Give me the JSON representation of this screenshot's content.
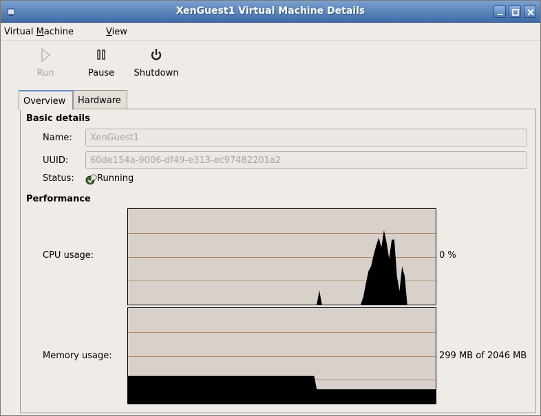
{
  "window": {
    "title": "XenGuest1 Virtual Machine Details"
  },
  "menubar": {
    "virtual_machine": {
      "prefix": "Virtual ",
      "mnemonic": "M",
      "suffix": "achine"
    },
    "view": {
      "prefix": "",
      "mnemonic": "V",
      "suffix": "iew"
    }
  },
  "toolbar": {
    "run": {
      "label": "Run",
      "icon": "play-icon",
      "enabled": false
    },
    "pause": {
      "label": "Pause",
      "icon": "pause-icon",
      "enabled": true
    },
    "shutdown": {
      "label": "Shutdown",
      "icon": "power-icon",
      "enabled": true
    }
  },
  "tabs": [
    {
      "label": "Overview",
      "active": true
    },
    {
      "label": "Hardware",
      "active": false
    }
  ],
  "basic_details": {
    "title": "Basic details",
    "name_label": "Name:",
    "name_value": "XenGuest1",
    "uuid_label": "UUID:",
    "uuid_value": "60de154a-9006-df49-e313-ec97482201a2",
    "status_label": "Status:",
    "status_value": "Running",
    "status_icon": "running-status-icon"
  },
  "performance": {
    "title": "Performance",
    "cpu": {
      "label": "CPU usage:",
      "value": "0 %",
      "history_percent": [
        0,
        0,
        0,
        0,
        0,
        0,
        0,
        0,
        0,
        0,
        0,
        0,
        0,
        0,
        0,
        0,
        0,
        0,
        0,
        0,
        0,
        0,
        0,
        0,
        0,
        0,
        0,
        0,
        0,
        0,
        0,
        0,
        0,
        0,
        0,
        0,
        0,
        0,
        0,
        0,
        0,
        0,
        0,
        0,
        0,
        0,
        0,
        0,
        0,
        0,
        0,
        0,
        0,
        0,
        0,
        0,
        0,
        0,
        0,
        0,
        0,
        0,
        0,
        0,
        0,
        0,
        0,
        0,
        0,
        0,
        0,
        0,
        0,
        0,
        15,
        0,
        0,
        0,
        0,
        0,
        0,
        0,
        0,
        0,
        0,
        0,
        0,
        0,
        0,
        0,
        0,
        8,
        22,
        35,
        40,
        52,
        62,
        70,
        60,
        78,
        65,
        48,
        68,
        68,
        30,
        14,
        40,
        30,
        0,
        0,
        0,
        0,
        0,
        0,
        0,
        0,
        0,
        0,
        0,
        0
      ]
    },
    "memory": {
      "label": "Memory usage:",
      "value": "299 MB of 2046 MB",
      "history_percent": [
        29,
        29,
        29,
        29,
        29,
        29,
        29,
        29,
        29,
        29,
        29,
        29,
        29,
        29,
        29,
        29,
        29,
        29,
        29,
        29,
        29,
        29,
        29,
        29,
        29,
        29,
        29,
        29,
        29,
        29,
        29,
        29,
        29,
        29,
        29,
        29,
        29,
        29,
        29,
        29,
        29,
        29,
        29,
        29,
        29,
        29,
        29,
        29,
        29,
        29,
        29,
        29,
        29,
        29,
        29,
        29,
        29,
        29,
        29,
        29,
        29,
        29,
        29,
        29,
        29,
        29,
        29,
        29,
        29,
        29,
        29,
        29,
        29,
        15,
        15,
        15,
        15,
        15,
        15,
        15,
        15,
        15,
        15,
        15,
        15,
        15,
        15,
        15,
        15,
        15,
        15,
        15,
        15,
        15,
        15,
        15,
        15,
        15,
        15,
        15,
        15,
        15,
        15,
        15,
        15,
        15,
        15,
        15,
        15,
        15,
        15,
        15,
        15,
        15,
        15,
        15,
        15,
        15,
        15,
        15
      ]
    }
  },
  "colors": {
    "titlebar_start": "#7aa0cf",
    "titlebar_end": "#3f6ca8",
    "graph_background": "#d8d1cb",
    "graph_fill": "#000000",
    "graph_grid": "#b08a6a",
    "active_tab_accent": "#5d8ac7"
  }
}
